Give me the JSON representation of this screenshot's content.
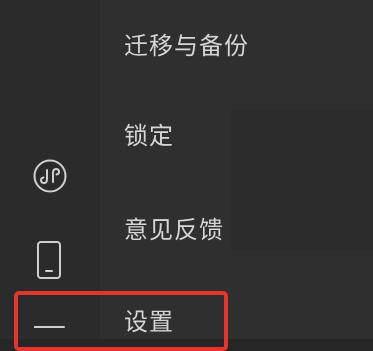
{
  "menu": {
    "items": [
      {
        "label": "迁移与备份"
      },
      {
        "label": "锁定"
      },
      {
        "label": "意见反馈"
      },
      {
        "label": "设置"
      }
    ]
  },
  "sidebar": {
    "icons": [
      "mini-program-icon",
      "phone-icon",
      "menu-icon"
    ]
  },
  "colors": {
    "highlight": "#e8342a",
    "menu_text": "#d6d6d6",
    "icon_stroke": "#cfcfcf"
  }
}
